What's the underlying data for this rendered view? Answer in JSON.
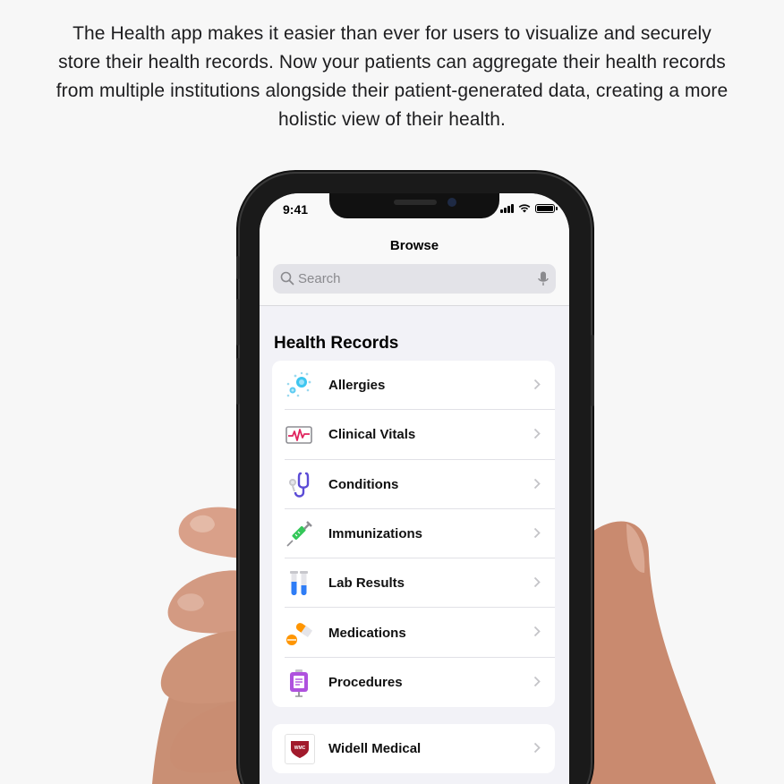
{
  "intro": {
    "text": "The Health app makes it easier than ever for users to visualize and securely store their health records. Now your patients can aggregate their health records from multiple institutions alongside their patient-generated data, creating a more holistic view of their health."
  },
  "status_bar": {
    "time": "9:41"
  },
  "nav": {
    "title": "Browse"
  },
  "search": {
    "placeholder": "Search",
    "value": ""
  },
  "section": {
    "title": "Health Records"
  },
  "records": [
    {
      "label": "Allergies",
      "icon": "allergies-icon"
    },
    {
      "label": "Clinical Vitals",
      "icon": "vitals-icon"
    },
    {
      "label": "Conditions",
      "icon": "stethoscope-icon"
    },
    {
      "label": "Immunizations",
      "icon": "syringe-icon"
    },
    {
      "label": "Lab Results",
      "icon": "test-tubes-icon"
    },
    {
      "label": "Medications",
      "icon": "pill-icon"
    },
    {
      "label": "Procedures",
      "icon": "clipboard-icon"
    }
  ],
  "providers": [
    {
      "label": "Widell Medical",
      "icon": "shield-logo-icon",
      "logo_text": "WMC"
    }
  ],
  "colors": {
    "accent_red": "#e0245e",
    "allergy_blue": "#3ec6f0",
    "conditions_purple": "#5b4bd6",
    "immunization_green": "#34c759",
    "lab_blue": "#2f7df6",
    "medication_orange": "#ff9500",
    "procedures_purple": "#af52de",
    "provider_red": "#a11a2c"
  }
}
